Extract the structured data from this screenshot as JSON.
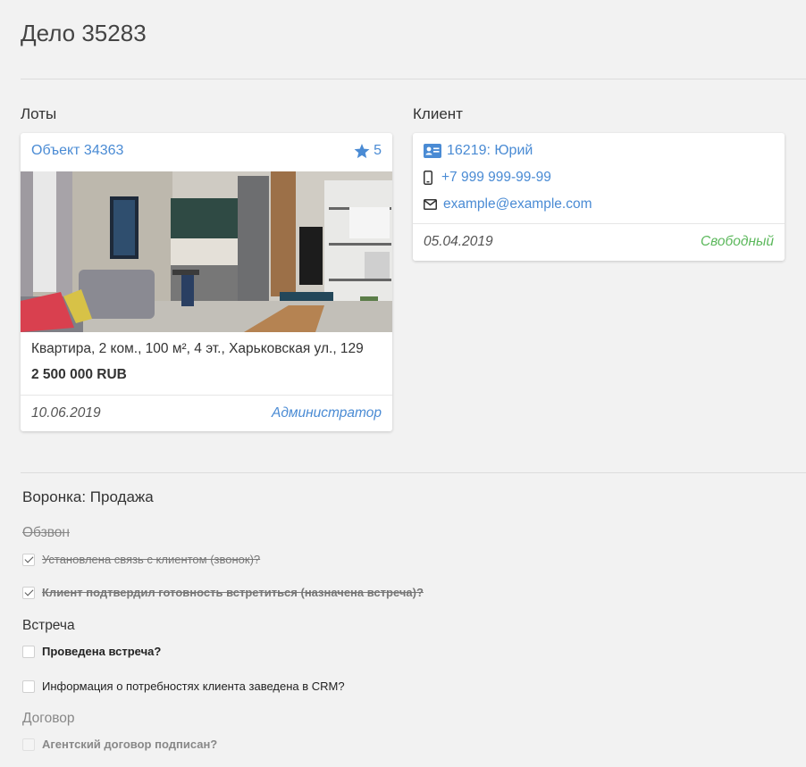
{
  "page": {
    "title": "Дело 35283"
  },
  "lots": {
    "label": "Лоты",
    "card": {
      "title": "Объект 34363",
      "rating": "5",
      "description": "Квартира, 2 ком., 100 м², 4 эт., Харьковская ул., 129",
      "price": "2 500 000 RUB",
      "date": "10.06.2019",
      "owner": "Администратор"
    }
  },
  "client": {
    "label": "Клиент",
    "card": {
      "name": "16219: Юрий",
      "phone": "+7 999 999-99-99",
      "email": "example@example.com",
      "date": "05.04.2019",
      "status": "Свободный",
      "status_color": "#5cb85c"
    }
  },
  "funnel": {
    "title": "Воронка: Продажа",
    "stages": [
      {
        "name": "Обзвон",
        "state": "done",
        "tasks": [
          {
            "label": "Установлена связь с клиентом (звонок)?",
            "checked": true
          },
          {
            "label": "Клиент подтвердил готовность встретиться (назначена встреча)?",
            "checked": true
          }
        ]
      },
      {
        "name": "Встреча",
        "state": "active",
        "tasks": [
          {
            "label": "Проведена встреча?",
            "checked": false
          },
          {
            "label": "Информация о потребностях клиента заведена в CRM?",
            "checked": false
          }
        ]
      },
      {
        "name": "Договор",
        "state": "future",
        "tasks": [
          {
            "label": "Агентский договор подписан?",
            "checked": false
          }
        ]
      }
    ]
  },
  "colors": {
    "link": "#4a8bd4",
    "owner": "#4a8bd4",
    "status": "#5cb85c"
  }
}
